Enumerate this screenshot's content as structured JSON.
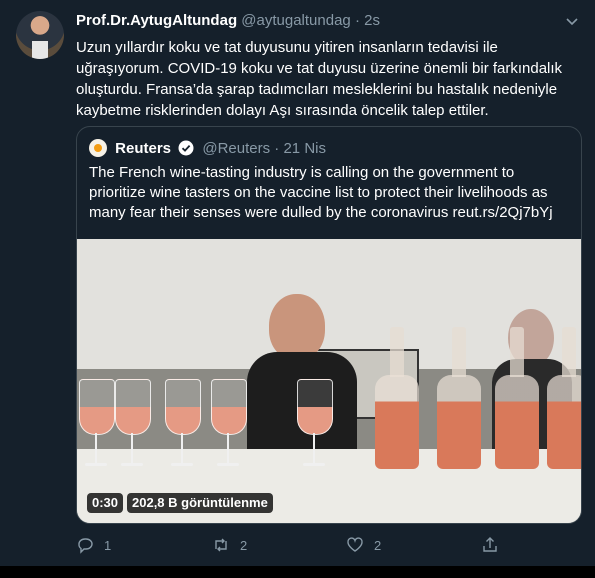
{
  "tweet": {
    "name": "Prof.Dr.AytugAltundag",
    "handle": "@aytugaltundag",
    "separator": "·",
    "time": "2s",
    "text": "Uzun yıllardır koku ve tat duyusunu yitiren insanların tedavisi ile uğraşıyorum. COVID-19 koku ve tat duyusu üzerine önemli bir farkındalık oluşturdu. Fransa’da şarap tadımcıları mesleklerini bu hastalık nedeniyle kaybetme risklerinden dolayı Aşı sırasında öncelik talep ettiler."
  },
  "quoted": {
    "name": "Reuters",
    "handle": "@Reuters",
    "separator": "·",
    "time": "21 Nis",
    "text": "The French wine-tasting industry is calling on the government to prioritize wine tasters on the vaccine list to protect their livelihoods as many fear their senses were dulled by the coronavirus reut.rs/2Qj7bYj",
    "video": {
      "duration": "0:30",
      "views": "202,8 B görüntülenme"
    }
  },
  "actions": {
    "replies": "1",
    "retweets": "2",
    "likes": "2"
  },
  "colors": {
    "background": "#15202b",
    "secondary_text": "#8899a6",
    "border": "#38444d",
    "verified": "#ffffff"
  },
  "icons": {
    "more": "chevron-down-icon",
    "verified": "verified-badge-icon",
    "reply": "reply-icon",
    "retweet": "retweet-icon",
    "like": "heart-icon",
    "share": "share-icon"
  }
}
